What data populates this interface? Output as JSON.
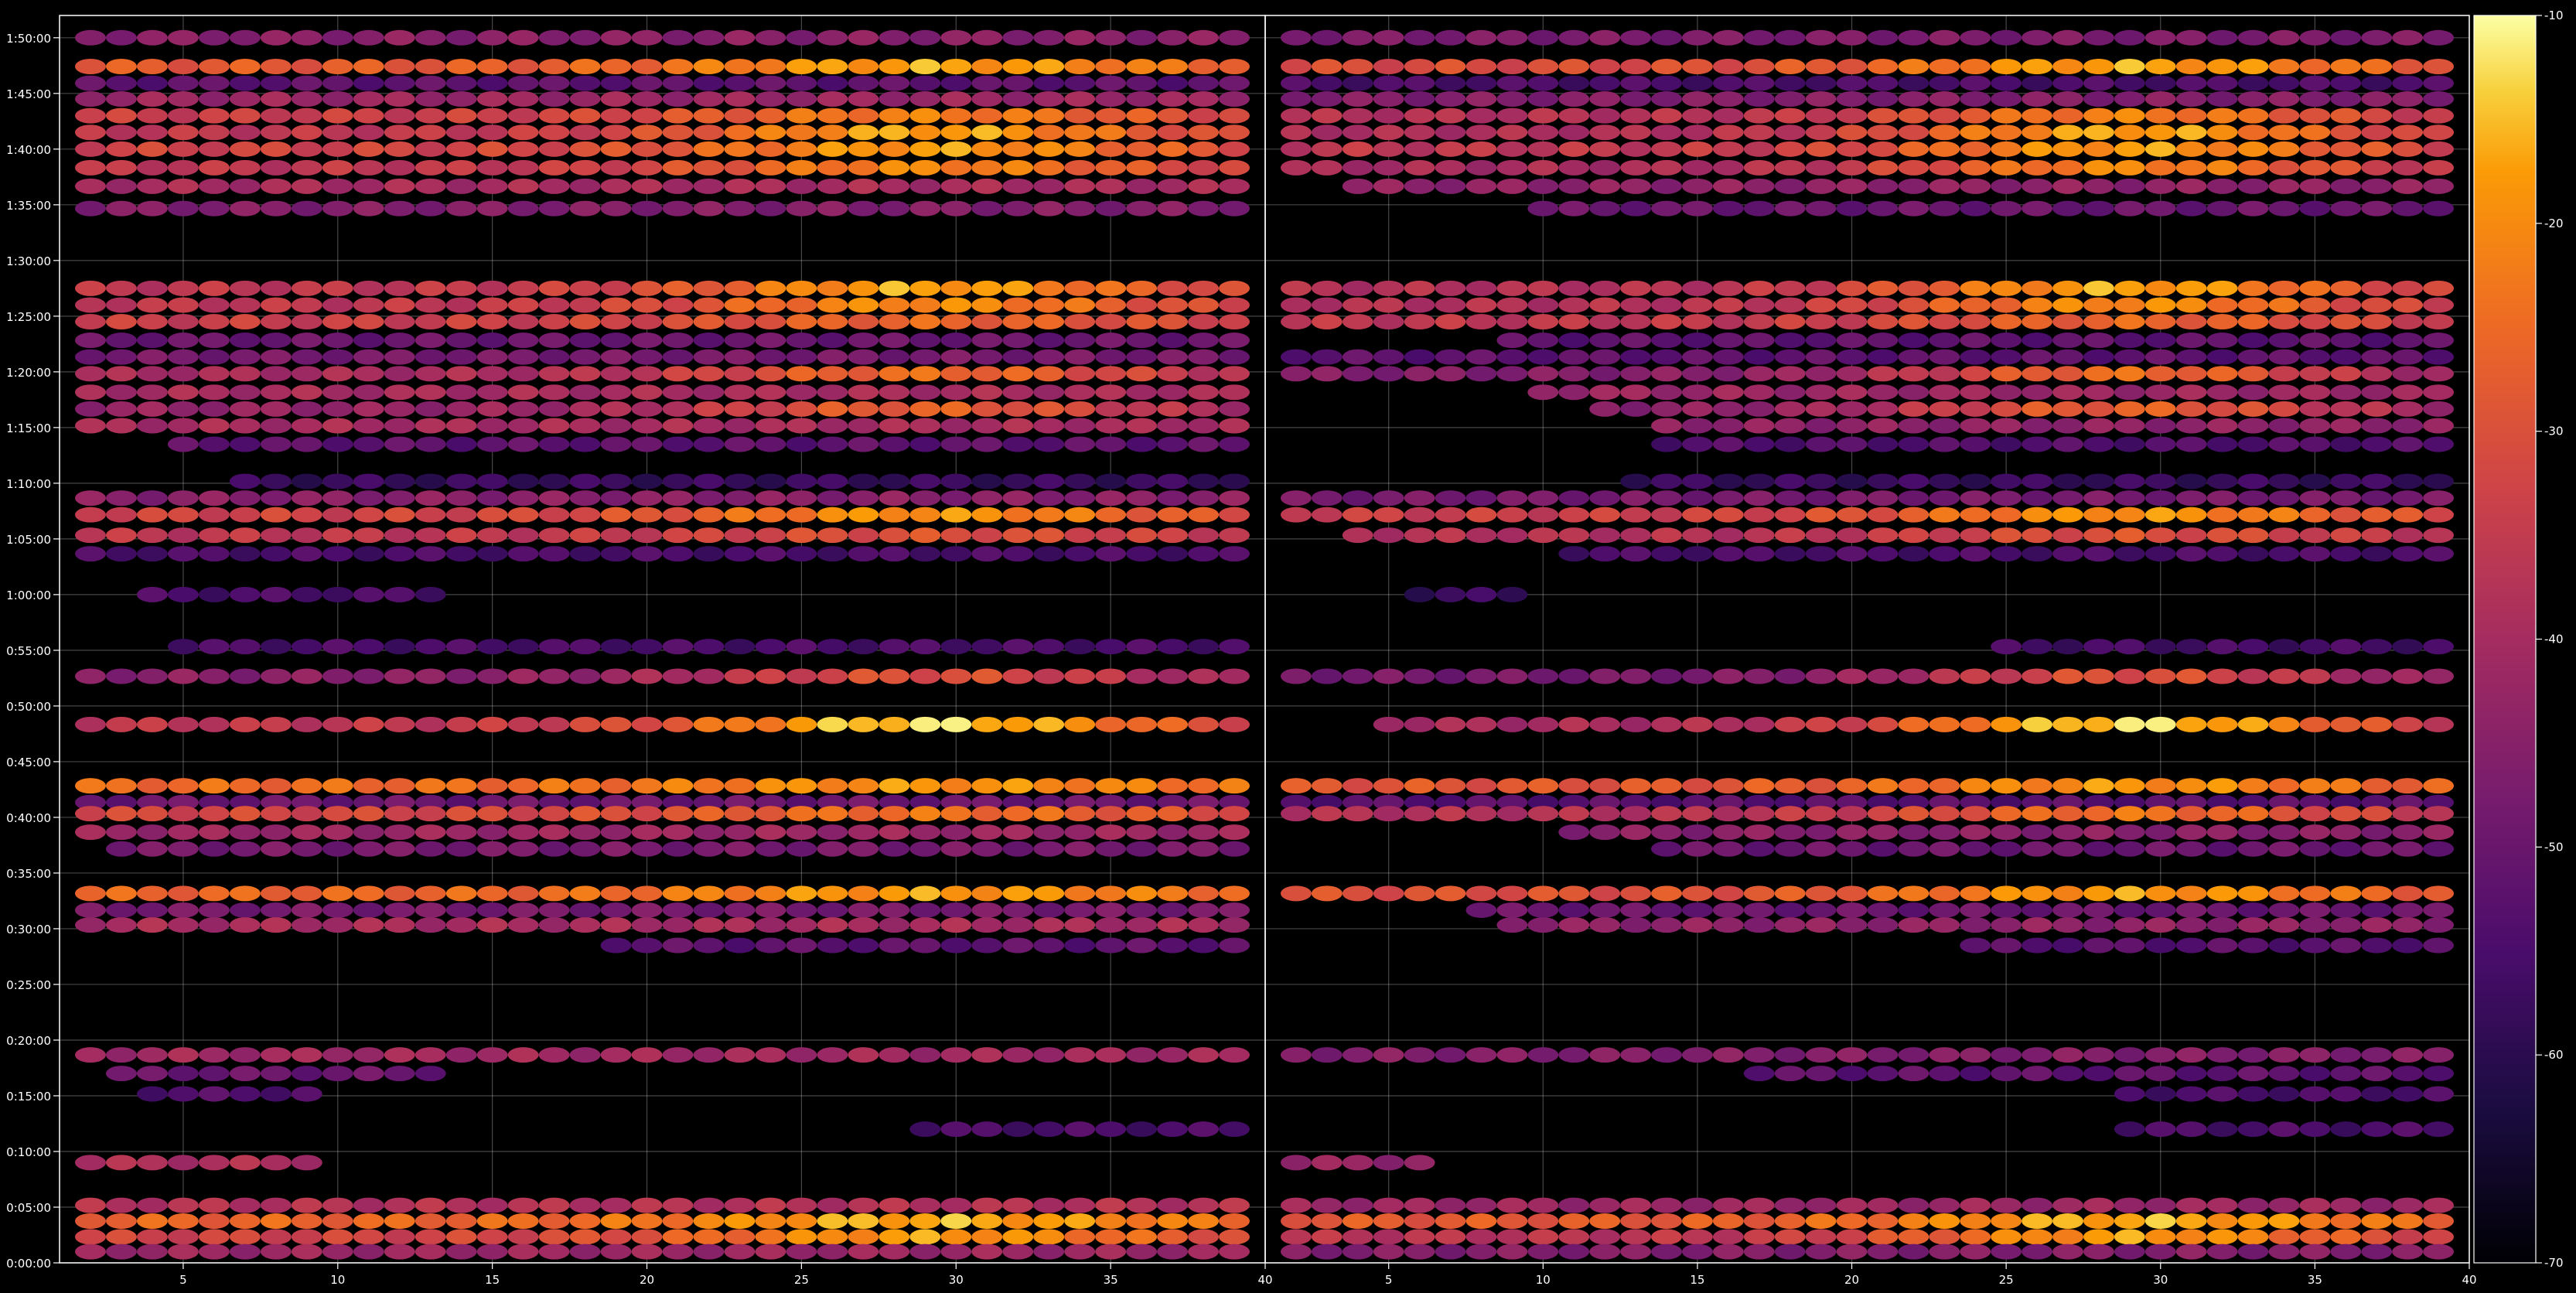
{
  "chart_data": {
    "type": "heatmap",
    "panels": [
      {
        "x_ticks": [
          5,
          10,
          15,
          20,
          25,
          30,
          35,
          40
        ],
        "xlim": [
          1,
          40
        ]
      },
      {
        "x_ticks": [
          5,
          10,
          15,
          20,
          25,
          30,
          35,
          40
        ],
        "xlim": [
          1,
          40
        ]
      }
    ],
    "y_ticks": [
      "0:00:00",
      "0:05:00",
      "0:10:00",
      "0:15:00",
      "0:20:00",
      "0:25:00",
      "0:30:00",
      "0:35:00",
      "0:40:00",
      "0:45:00",
      "0:50:00",
      "0:55:00",
      "1:00:00",
      "1:05:00",
      "1:10:00",
      "1:15:00",
      "1:20:00",
      "1:25:00",
      "1:30:00",
      "1:35:00",
      "1:40:00",
      "1:45:00",
      "1:50:00"
    ],
    "ylim_seconds": [
      0,
      6720
    ],
    "grid": true,
    "colormap": "inferno",
    "colorbar": {
      "ticks": [
        -10,
        -20,
        -30,
        -40,
        -50,
        -60,
        -70
      ],
      "range": [
        -70,
        -10
      ]
    },
    "columns_x": [
      2,
      40
    ],
    "bands": [
      {
        "t": 6600,
        "left": {
          "from": 2,
          "to": 39,
          "level": -45
        },
        "right": {
          "from": 2,
          "to": 39,
          "level": -47
        }
      },
      {
        "t": 6445,
        "left": {
          "from": 2,
          "to": 39,
          "level": -28,
          "peak": -17
        },
        "right": {
          "from": 2,
          "to": 39,
          "level": -31,
          "peak": -17
        }
      },
      {
        "t": 6355,
        "left": {
          "from": 2,
          "to": 39,
          "level": -52
        },
        "right": {
          "from": 2,
          "to": 39,
          "level": -55
        }
      },
      {
        "t": 6270,
        "left": {
          "from": 2,
          "to": 39,
          "level": -42
        },
        "right": {
          "from": 2,
          "to": 39,
          "level": -46
        }
      },
      {
        "t": 6180,
        "left": {
          "from": 2,
          "to": 39,
          "level": -34,
          "peak": -22
        },
        "right": {
          "from": 2,
          "to": 39,
          "level": -38,
          "peak": -22
        }
      },
      {
        "t": 6090,
        "left": {
          "from": 2,
          "to": 39,
          "level": -36,
          "peak": -17
        },
        "right": {
          "from": 2,
          "to": 39,
          "level": -39,
          "peak": -17
        }
      },
      {
        "t": 6000,
        "left": {
          "from": 2,
          "to": 39,
          "level": -33,
          "peak": -18
        },
        "right": {
          "from": 2,
          "to": 39,
          "level": -36,
          "peak": -18
        }
      },
      {
        "t": 5900,
        "left": {
          "from": 2,
          "to": 39,
          "level": -36,
          "peak": -21
        },
        "right": {
          "from": 2,
          "to": 39,
          "level": -40,
          "peak": -21
        }
      },
      {
        "t": 5800,
        "left": {
          "from": 2,
          "to": 39,
          "level": -40
        },
        "right": {
          "from": 4,
          "to": 39,
          "level": -44
        }
      },
      {
        "t": 5680,
        "left": {
          "from": 2,
          "to": 39,
          "level": -46
        },
        "right": {
          "from": 10,
          "to": 39,
          "level": -50
        }
      },
      {
        "t": 5250,
        "left": {
          "from": 2,
          "to": 39,
          "level": -36,
          "peak": -17
        },
        "right": {
          "from": 2,
          "to": 39,
          "level": -38,
          "peak": -17
        }
      },
      {
        "t": 5160,
        "left": {
          "from": 2,
          "to": 39,
          "level": -36,
          "peak": -20
        },
        "right": {
          "from": 2,
          "to": 39,
          "level": -38,
          "peak": -20
        }
      },
      {
        "t": 5070,
        "left": {
          "from": 2,
          "to": 39,
          "level": -34,
          "peak": -26
        },
        "right": {
          "from": 2,
          "to": 39,
          "level": -36,
          "peak": -26
        }
      },
      {
        "t": 4970,
        "left": {
          "from": 2,
          "to": 39,
          "level": -50
        },
        "right": {
          "from": 9,
          "to": 39,
          "level": -52
        }
      },
      {
        "t": 4880,
        "left": {
          "from": 2,
          "to": 39,
          "level": -48
        },
        "right": {
          "from": 2,
          "to": 39,
          "level": -52
        }
      },
      {
        "t": 4790,
        "left": {
          "from": 2,
          "to": 39,
          "level": -40,
          "peak": -25
        },
        "right": {
          "from": 2,
          "to": 39,
          "level": -46,
          "peak": -25
        }
      },
      {
        "t": 4690,
        "left": {
          "from": 2,
          "to": 39,
          "level": -40
        },
        "right": {
          "from": 10,
          "to": 39,
          "level": -42
        }
      },
      {
        "t": 4600,
        "left": {
          "from": 2,
          "to": 39,
          "level": -43,
          "peak": -27
        },
        "right": {
          "from": 12,
          "to": 39,
          "level": -45,
          "peak": -27
        }
      },
      {
        "t": 4510,
        "left": {
          "from": 2,
          "to": 39,
          "level": -40
        },
        "right": {
          "from": 14,
          "to": 39,
          "level": -44
        }
      },
      {
        "t": 4410,
        "left": {
          "from": 5,
          "to": 39,
          "level": -52
        },
        "right": {
          "from": 14,
          "to": 39,
          "level": -54
        }
      },
      {
        "t": 4210,
        "left": {
          "from": 7,
          "to": 39,
          "level": -58
        },
        "right": {
          "from": 13,
          "to": 39,
          "level": -58
        }
      },
      {
        "t": 4120,
        "left": {
          "from": 2,
          "to": 39,
          "level": -45
        },
        "right": {
          "from": 2,
          "to": 39,
          "level": -48
        }
      },
      {
        "t": 4030,
        "left": {
          "from": 2,
          "to": 39,
          "level": -33,
          "peak": -19
        },
        "right": {
          "from": 2,
          "to": 39,
          "level": -34,
          "peak": -19
        }
      },
      {
        "t": 3920,
        "left": {
          "from": 2,
          "to": 39,
          "level": -36,
          "peak": -30
        },
        "right": {
          "from": 4,
          "to": 39,
          "level": -38,
          "peak": -30
        }
      },
      {
        "t": 3820,
        "left": {
          "from": 2,
          "to": 39,
          "level": -55
        },
        "right": {
          "from": 11,
          "to": 39,
          "level": -55
        }
      },
      {
        "t": 3600,
        "left": {
          "from": 4,
          "to": 13,
          "level": -55
        },
        "right": {
          "from": 6,
          "to": 9,
          "level": -58
        }
      },
      {
        "t": 3320,
        "left": {
          "from": 5,
          "to": 39,
          "level": -55
        },
        "right": {
          "from": 25,
          "to": 39,
          "level": -56
        }
      },
      {
        "t": 3160,
        "left": {
          "from": 2,
          "to": 39,
          "level": -45,
          "peak": -30
        },
        "right": {
          "from": 2,
          "to": 39,
          "level": -48,
          "peak": -30
        }
      },
      {
        "t": 2900,
        "left": {
          "from": 2,
          "to": 39,
          "level": -36,
          "peak": -13
        },
        "right": {
          "from": 5,
          "to": 39,
          "level": -40,
          "peak": -13
        }
      },
      {
        "t": 2570,
        "left": {
          "from": 2,
          "to": 39,
          "level": -25,
          "peak": -19
        },
        "right": {
          "from": 2,
          "to": 39,
          "level": -29,
          "peak": -19
        }
      },
      {
        "t": 2480,
        "left": {
          "from": 2,
          "to": 39,
          "level": -50
        },
        "right": {
          "from": 2,
          "to": 39,
          "level": -53
        }
      },
      {
        "t": 2420,
        "left": {
          "from": 2,
          "to": 39,
          "level": -32,
          "peak": -24
        },
        "right": {
          "from": 2,
          "to": 39,
          "level": -38,
          "peak": -24
        }
      },
      {
        "t": 2320,
        "left": {
          "from": 2,
          "to": 39,
          "level": -42
        },
        "right": {
          "from": 11,
          "to": 39,
          "level": -45
        }
      },
      {
        "t": 2230,
        "left": {
          "from": 3,
          "to": 39,
          "level": -48
        },
        "right": {
          "from": 14,
          "to": 39,
          "level": -50
        }
      },
      {
        "t": 1990,
        "left": {
          "from": 2,
          "to": 39,
          "level": -26,
          "peak": -18
        },
        "right": {
          "from": 2,
          "to": 39,
          "level": -30,
          "peak": -18
        }
      },
      {
        "t": 1900,
        "left": {
          "from": 2,
          "to": 39,
          "level": -48
        },
        "right": {
          "from": 8,
          "to": 39,
          "level": -50
        }
      },
      {
        "t": 1820,
        "left": {
          "from": 2,
          "to": 39,
          "level": -40
        },
        "right": {
          "from": 9,
          "to": 39,
          "level": -44
        }
      },
      {
        "t": 1710,
        "left": {
          "from": 19,
          "to": 39,
          "level": -52
        },
        "right": {
          "from": 24,
          "to": 39,
          "level": -53
        }
      },
      {
        "t": 1120,
        "left": {
          "from": 2,
          "to": 39,
          "level": -41
        },
        "right": {
          "from": 2,
          "to": 39,
          "level": -46
        }
      },
      {
        "t": 1020,
        "left": {
          "from": 3,
          "to": 13,
          "level": -50
        },
        "right": {
          "from": 17,
          "to": 39,
          "level": -52
        }
      },
      {
        "t": 910,
        "left": {
          "from": 4,
          "to": 9,
          "level": -54
        },
        "right": {
          "from": 29,
          "to": 39,
          "level": -55
        }
      },
      {
        "t": 720,
        "left": {
          "from": 29,
          "to": 39,
          "level": -55
        },
        "right": {
          "from": 29,
          "to": 39,
          "level": -55
        }
      },
      {
        "t": 540,
        "left": {
          "from": 2,
          "to": 9,
          "level": -39
        },
        "right": {
          "from": 2,
          "to": 6,
          "level": -43
        }
      },
      {
        "t": 310,
        "left": {
          "from": 2,
          "to": 39,
          "level": -38
        },
        "right": {
          "from": 2,
          "to": 39,
          "level": -42
        }
      },
      {
        "t": 225,
        "left": {
          "from": 2,
          "to": 39,
          "level": -26,
          "peak": -16
        },
        "right": {
          "from": 2,
          "to": 39,
          "level": -28,
          "peak": -16
        }
      },
      {
        "t": 140,
        "left": {
          "from": 2,
          "to": 39,
          "level": -33,
          "peak": -18
        },
        "right": {
          "from": 2,
          "to": 39,
          "level": -37,
          "peak": -18
        }
      },
      {
        "t": 60,
        "left": {
          "from": 2,
          "to": 39,
          "level": -42
        },
        "right": {
          "from": 2,
          "to": 39,
          "level": -46
        }
      }
    ]
  }
}
